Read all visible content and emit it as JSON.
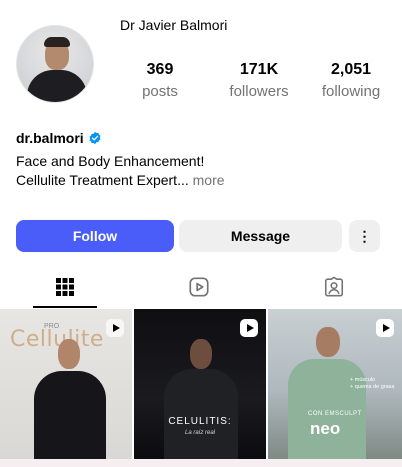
{
  "profile": {
    "full_name": "Dr Javier Balmori",
    "username": "dr.balmori",
    "verified": true,
    "bio_line1": "Face and Body Enhancement!",
    "bio_line2": "Cellulite Treatment Expert...",
    "bio_more": "more"
  },
  "stats": [
    {
      "value": "369",
      "label": "posts"
    },
    {
      "value": "171K",
      "label": "followers"
    },
    {
      "value": "2,051",
      "label": "following"
    }
  ],
  "actions": {
    "follow_label": "Follow",
    "message_label": "Message",
    "more_label": "⋮"
  },
  "tabs": [
    {
      "icon": "grid-icon",
      "active": true
    },
    {
      "icon": "reels-icon",
      "active": false
    },
    {
      "icon": "tagged-icon",
      "active": false
    }
  ],
  "posts": [
    {
      "type": "reel",
      "overlay_title": "Cellulite",
      "overlay_sub": "PRO"
    },
    {
      "type": "reel",
      "overlay_title": "CELULITIS:",
      "overlay_sub": "La raíz real"
    },
    {
      "type": "reel",
      "overlay_text": "+ músculo\n+ quema de grasa",
      "brand": "EMSCULPT",
      "brand_prefix": "CON",
      "product": "neo"
    }
  ],
  "colors": {
    "follow_button": "#4a5df9",
    "secondary_button": "#efefef",
    "muted_text": "#737373",
    "verified_badge": "#0095f6"
  }
}
